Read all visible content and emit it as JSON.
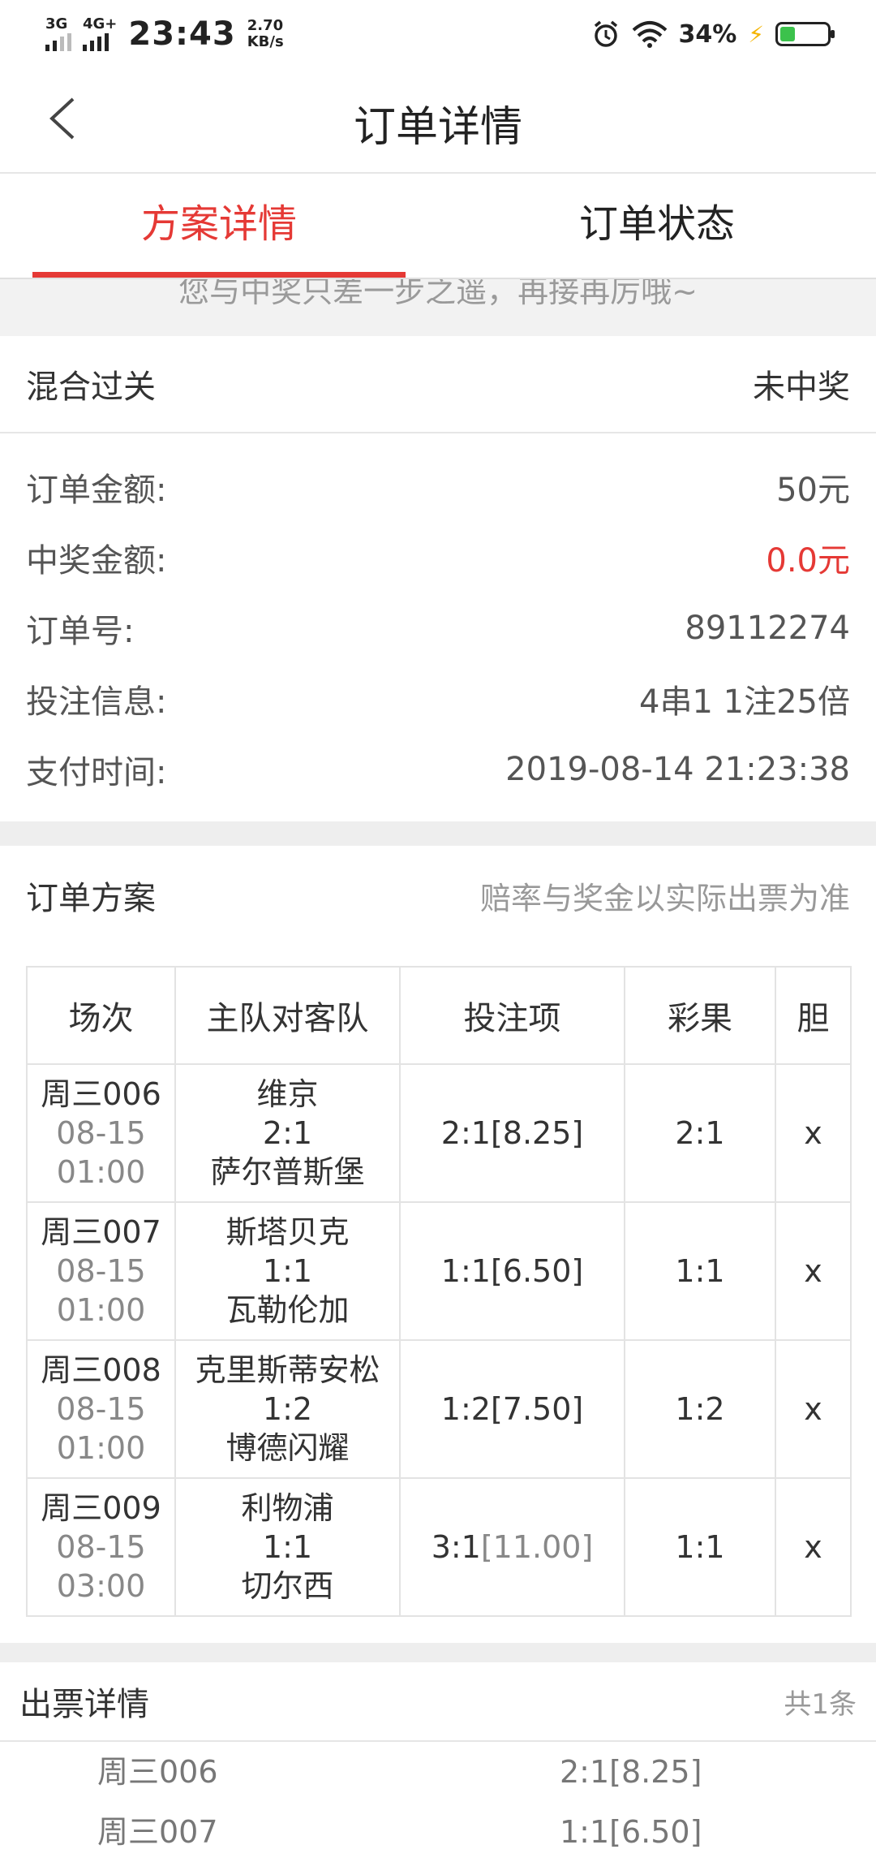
{
  "status_bar": {
    "net1": "3G",
    "net2": "4G+",
    "time": "23:43",
    "speed_value": "2.70",
    "speed_unit": "KB/s",
    "battery": "34%",
    "battery_color": "#3cc24c"
  },
  "nav": {
    "title": "订单详情"
  },
  "tabs": [
    {
      "label": "方案详情",
      "active": true
    },
    {
      "label": "订单状态",
      "active": false
    }
  ],
  "accent_color": "#e53935",
  "notice": "您与中奖只差一步之遥，再接再厉哦~",
  "summary": {
    "play_type": "混合过关",
    "result": "未中奖",
    "rows": [
      {
        "label": "订单金额:",
        "value": "50元"
      },
      {
        "label": "中奖金额:",
        "value": "0.0元"
      },
      {
        "label": "订单号:",
        "value": "89112274"
      },
      {
        "label": "投注信息:",
        "value": "4串1 1注25倍"
      },
      {
        "label": "支付时间:",
        "value": "2019-08-14 21:23:38"
      }
    ]
  },
  "plan": {
    "title": "订单方案",
    "note": "赔率与奖金以实际出票为准",
    "headers": [
      "场次",
      "主队对客队",
      "投注项",
      "彩果",
      "胆"
    ],
    "rows": [
      {
        "match_no": "周三006",
        "date": "08-15",
        "time": "01:00",
        "home": "维京",
        "score": "2:1",
        "away": "萨尔普斯堡",
        "bet": "2:1[8.25]",
        "result": "2:1",
        "banker": "x"
      },
      {
        "match_no": "周三007",
        "date": "08-15",
        "time": "01:00",
        "home": "斯塔贝克",
        "score": "1:1",
        "away": "瓦勒伦加",
        "bet": "1:1[6.50]",
        "result": "1:1",
        "banker": "x"
      },
      {
        "match_no": "周三008",
        "date": "08-15",
        "time": "01:00",
        "home": "克里斯蒂安松",
        "score": "1:2",
        "away": "博德闪耀",
        "bet": "1:2[7.50]",
        "result": "1:2",
        "banker": "x"
      },
      {
        "match_no": "周三009",
        "date": "08-15",
        "time": "03:00",
        "home": "利物浦",
        "score": "1:1",
        "away": "切尔西",
        "bet_pick": "3:1",
        "bet_odds": "[11.00]",
        "result": "1:1",
        "banker": "x"
      }
    ]
  },
  "tickets": {
    "title": "出票详情",
    "count": "共1条",
    "rows": [
      {
        "match": "周三006",
        "pick": "2:1[8.25]"
      },
      {
        "match": "周三007",
        "pick": "1:1[6.50]"
      }
    ]
  }
}
